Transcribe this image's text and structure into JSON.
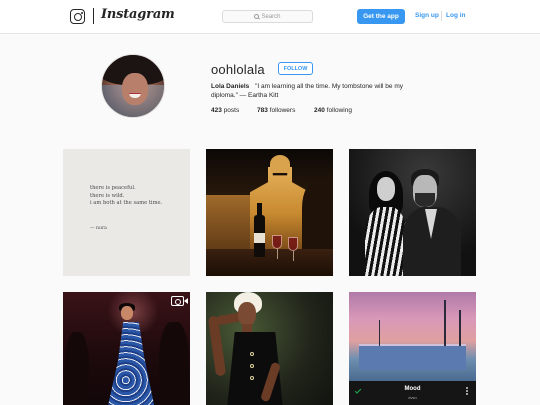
{
  "nav": {
    "brand": "Instagram",
    "search_placeholder": "Search",
    "get_app_label": "Get the app",
    "signup_label": "Sign up",
    "login_label": "Log in"
  },
  "profile": {
    "username": "oohlolala",
    "follow_label": "FOLLOW",
    "full_name": "Lola Daniels",
    "bio_text": "\"I am learning all the time. My tombstone will be my diploma.\" — Eartha Kitt",
    "posts_count": "423",
    "posts_label": "posts",
    "followers_count": "783",
    "followers_label": "followers",
    "following_count": "240",
    "following_label": "following"
  },
  "posts": {
    "poem_lines": [
      "there is peaceful.",
      "there is wild.",
      "i am both at the same time."
    ],
    "poem_signature": "— nura",
    "music_title": "Mood",
    "music_artist": "dvsn"
  },
  "colors": {
    "accent": "#3897f0",
    "text": "#262626",
    "background": "#fafafa"
  }
}
